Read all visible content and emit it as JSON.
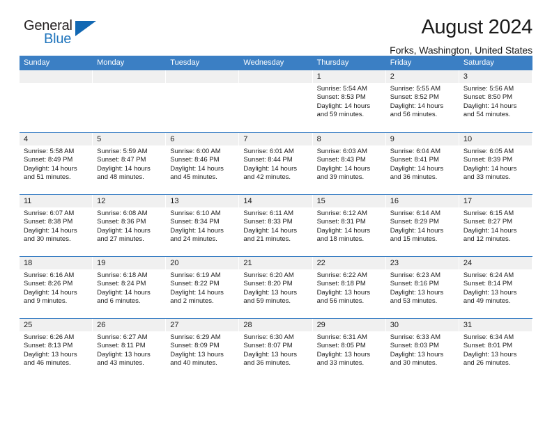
{
  "brand": {
    "name_top": "General",
    "name_bottom": "Blue",
    "accent_color": "#1268b3",
    "blue_text_color": "#2276bd"
  },
  "header": {
    "title": "August 2024",
    "subtitle": "Forks, Washington, United States"
  },
  "calendar": {
    "header_bg": "#3b7fc4",
    "day_band_bg": "#f0f0f0",
    "weekdays": [
      "Sunday",
      "Monday",
      "Tuesday",
      "Wednesday",
      "Thursday",
      "Friday",
      "Saturday"
    ],
    "weeks": [
      [
        {
          "day": "",
          "empty": true
        },
        {
          "day": "",
          "empty": true
        },
        {
          "day": "",
          "empty": true
        },
        {
          "day": "",
          "empty": true
        },
        {
          "day": "1",
          "sunrise": "Sunrise: 5:54 AM",
          "sunset": "Sunset: 8:53 PM",
          "daylight_line1": "Daylight: 14 hours",
          "daylight_line2": "and 59 minutes."
        },
        {
          "day": "2",
          "sunrise": "Sunrise: 5:55 AM",
          "sunset": "Sunset: 8:52 PM",
          "daylight_line1": "Daylight: 14 hours",
          "daylight_line2": "and 56 minutes."
        },
        {
          "day": "3",
          "sunrise": "Sunrise: 5:56 AM",
          "sunset": "Sunset: 8:50 PM",
          "daylight_line1": "Daylight: 14 hours",
          "daylight_line2": "and 54 minutes."
        }
      ],
      [
        {
          "day": "4",
          "sunrise": "Sunrise: 5:58 AM",
          "sunset": "Sunset: 8:49 PM",
          "daylight_line1": "Daylight: 14 hours",
          "daylight_line2": "and 51 minutes."
        },
        {
          "day": "5",
          "sunrise": "Sunrise: 5:59 AM",
          "sunset": "Sunset: 8:47 PM",
          "daylight_line1": "Daylight: 14 hours",
          "daylight_line2": "and 48 minutes."
        },
        {
          "day": "6",
          "sunrise": "Sunrise: 6:00 AM",
          "sunset": "Sunset: 8:46 PM",
          "daylight_line1": "Daylight: 14 hours",
          "daylight_line2": "and 45 minutes."
        },
        {
          "day": "7",
          "sunrise": "Sunrise: 6:01 AM",
          "sunset": "Sunset: 8:44 PM",
          "daylight_line1": "Daylight: 14 hours",
          "daylight_line2": "and 42 minutes."
        },
        {
          "day": "8",
          "sunrise": "Sunrise: 6:03 AM",
          "sunset": "Sunset: 8:43 PM",
          "daylight_line1": "Daylight: 14 hours",
          "daylight_line2": "and 39 minutes."
        },
        {
          "day": "9",
          "sunrise": "Sunrise: 6:04 AM",
          "sunset": "Sunset: 8:41 PM",
          "daylight_line1": "Daylight: 14 hours",
          "daylight_line2": "and 36 minutes."
        },
        {
          "day": "10",
          "sunrise": "Sunrise: 6:05 AM",
          "sunset": "Sunset: 8:39 PM",
          "daylight_line1": "Daylight: 14 hours",
          "daylight_line2": "and 33 minutes."
        }
      ],
      [
        {
          "day": "11",
          "sunrise": "Sunrise: 6:07 AM",
          "sunset": "Sunset: 8:38 PM",
          "daylight_line1": "Daylight: 14 hours",
          "daylight_line2": "and 30 minutes."
        },
        {
          "day": "12",
          "sunrise": "Sunrise: 6:08 AM",
          "sunset": "Sunset: 8:36 PM",
          "daylight_line1": "Daylight: 14 hours",
          "daylight_line2": "and 27 minutes."
        },
        {
          "day": "13",
          "sunrise": "Sunrise: 6:10 AM",
          "sunset": "Sunset: 8:34 PM",
          "daylight_line1": "Daylight: 14 hours",
          "daylight_line2": "and 24 minutes."
        },
        {
          "day": "14",
          "sunrise": "Sunrise: 6:11 AM",
          "sunset": "Sunset: 8:33 PM",
          "daylight_line1": "Daylight: 14 hours",
          "daylight_line2": "and 21 minutes."
        },
        {
          "day": "15",
          "sunrise": "Sunrise: 6:12 AM",
          "sunset": "Sunset: 8:31 PM",
          "daylight_line1": "Daylight: 14 hours",
          "daylight_line2": "and 18 minutes."
        },
        {
          "day": "16",
          "sunrise": "Sunrise: 6:14 AM",
          "sunset": "Sunset: 8:29 PM",
          "daylight_line1": "Daylight: 14 hours",
          "daylight_line2": "and 15 minutes."
        },
        {
          "day": "17",
          "sunrise": "Sunrise: 6:15 AM",
          "sunset": "Sunset: 8:27 PM",
          "daylight_line1": "Daylight: 14 hours",
          "daylight_line2": "and 12 minutes."
        }
      ],
      [
        {
          "day": "18",
          "sunrise": "Sunrise: 6:16 AM",
          "sunset": "Sunset: 8:26 PM",
          "daylight_line1": "Daylight: 14 hours",
          "daylight_line2": "and 9 minutes."
        },
        {
          "day": "19",
          "sunrise": "Sunrise: 6:18 AM",
          "sunset": "Sunset: 8:24 PM",
          "daylight_line1": "Daylight: 14 hours",
          "daylight_line2": "and 6 minutes."
        },
        {
          "day": "20",
          "sunrise": "Sunrise: 6:19 AM",
          "sunset": "Sunset: 8:22 PM",
          "daylight_line1": "Daylight: 14 hours",
          "daylight_line2": "and 2 minutes."
        },
        {
          "day": "21",
          "sunrise": "Sunrise: 6:20 AM",
          "sunset": "Sunset: 8:20 PM",
          "daylight_line1": "Daylight: 13 hours",
          "daylight_line2": "and 59 minutes."
        },
        {
          "day": "22",
          "sunrise": "Sunrise: 6:22 AM",
          "sunset": "Sunset: 8:18 PM",
          "daylight_line1": "Daylight: 13 hours",
          "daylight_line2": "and 56 minutes."
        },
        {
          "day": "23",
          "sunrise": "Sunrise: 6:23 AM",
          "sunset": "Sunset: 8:16 PM",
          "daylight_line1": "Daylight: 13 hours",
          "daylight_line2": "and 53 minutes."
        },
        {
          "day": "24",
          "sunrise": "Sunrise: 6:24 AM",
          "sunset": "Sunset: 8:14 PM",
          "daylight_line1": "Daylight: 13 hours",
          "daylight_line2": "and 49 minutes."
        }
      ],
      [
        {
          "day": "25",
          "sunrise": "Sunrise: 6:26 AM",
          "sunset": "Sunset: 8:13 PM",
          "daylight_line1": "Daylight: 13 hours",
          "daylight_line2": "and 46 minutes."
        },
        {
          "day": "26",
          "sunrise": "Sunrise: 6:27 AM",
          "sunset": "Sunset: 8:11 PM",
          "daylight_line1": "Daylight: 13 hours",
          "daylight_line2": "and 43 minutes."
        },
        {
          "day": "27",
          "sunrise": "Sunrise: 6:29 AM",
          "sunset": "Sunset: 8:09 PM",
          "daylight_line1": "Daylight: 13 hours",
          "daylight_line2": "and 40 minutes."
        },
        {
          "day": "28",
          "sunrise": "Sunrise: 6:30 AM",
          "sunset": "Sunset: 8:07 PM",
          "daylight_line1": "Daylight: 13 hours",
          "daylight_line2": "and 36 minutes."
        },
        {
          "day": "29",
          "sunrise": "Sunrise: 6:31 AM",
          "sunset": "Sunset: 8:05 PM",
          "daylight_line1": "Daylight: 13 hours",
          "daylight_line2": "and 33 minutes."
        },
        {
          "day": "30",
          "sunrise": "Sunrise: 6:33 AM",
          "sunset": "Sunset: 8:03 PM",
          "daylight_line1": "Daylight: 13 hours",
          "daylight_line2": "and 30 minutes."
        },
        {
          "day": "31",
          "sunrise": "Sunrise: 6:34 AM",
          "sunset": "Sunset: 8:01 PM",
          "daylight_line1": "Daylight: 13 hours",
          "daylight_line2": "and 26 minutes."
        }
      ]
    ]
  }
}
